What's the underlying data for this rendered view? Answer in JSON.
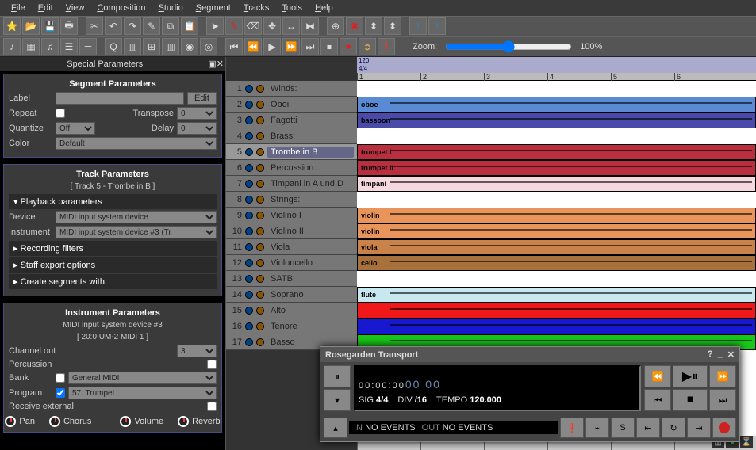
{
  "menu": [
    "File",
    "Edit",
    "View",
    "Composition",
    "Studio",
    "Segment",
    "Tracks",
    "Tools",
    "Help"
  ],
  "zoom": {
    "label": "Zoom:",
    "value": "100%"
  },
  "special_parameters_title": "Special Parameters",
  "seg_params": {
    "title": "Segment Parameters",
    "label_lbl": "Label",
    "edit_btn": "Edit",
    "repeat_lbl": "Repeat",
    "transpose_lbl": "Transpose",
    "transpose_val": "0",
    "quantize_lbl": "Quantize",
    "quantize_val": "Off",
    "delay_lbl": "Delay",
    "delay_val": "0",
    "color_lbl": "Color",
    "color_val": "Default"
  },
  "trk_params": {
    "title": "Track Parameters",
    "sub": "[ Track 5 - Trombe in B ]",
    "playback": "Playback parameters",
    "device_lbl": "Device",
    "device_val": "MIDI input system device",
    "instrument_lbl": "Instrument",
    "instrument_val": "MIDI input system device #3 (Tr",
    "rec": "Recording filters",
    "staff": "Staff export options",
    "create": "Create segments with"
  },
  "inst_params": {
    "title": "Instrument Parameters",
    "sub1": "MIDI input system device  #3",
    "sub2": "[ 20:0 UM-2 MIDI 1 ]",
    "channel_lbl": "Channel out",
    "channel_val": "3",
    "percussion_lbl": "Percussion",
    "bank_lbl": "Bank",
    "bank_val": "General MIDI",
    "program_lbl": "Program",
    "program_val": "57. Trumpet",
    "receive_lbl": "Receive external",
    "knobs": [
      "Pan",
      "Chorus",
      "Volume",
      "Reverb"
    ]
  },
  "tracks": [
    {
      "n": 1,
      "name": "Winds:"
    },
    {
      "n": 2,
      "name": "Oboi"
    },
    {
      "n": 3,
      "name": "Fagotti"
    },
    {
      "n": 4,
      "name": "Brass:"
    },
    {
      "n": 5,
      "name": "Trombe in B",
      "sel": true
    },
    {
      "n": 6,
      "name": "Percussion:"
    },
    {
      "n": 7,
      "name": "Timpani in A und D"
    },
    {
      "n": 8,
      "name": "Strings:"
    },
    {
      "n": 9,
      "name": "Violino I"
    },
    {
      "n": 10,
      "name": "Violino II"
    },
    {
      "n": 11,
      "name": "Viola"
    },
    {
      "n": 12,
      "name": "Violoncello"
    },
    {
      "n": 13,
      "name": "SATB:"
    },
    {
      "n": 14,
      "name": "Soprano"
    },
    {
      "n": 15,
      "name": "Alto"
    },
    {
      "n": 16,
      "name": "Tenore"
    },
    {
      "n": 17,
      "name": "Basso"
    }
  ],
  "ruler": {
    "tempo": "120",
    "sig": "4/4",
    "bars": [
      "1",
      "2",
      "3",
      "4",
      "5",
      "6"
    ]
  },
  "segments": [
    {
      "row": 1,
      "label": "oboe",
      "color": "#5a8ad4"
    },
    {
      "row": 2,
      "label": "bassoon",
      "color": "#4a4aa8"
    },
    {
      "row": 4,
      "label": "trumpet I",
      "color": "#b83040"
    },
    {
      "row": 5,
      "label": "trumpet II",
      "color": "#b83040"
    },
    {
      "row": 6,
      "label": "timpani",
      "color": "#f8d8e0"
    },
    {
      "row": 8,
      "label": "violin",
      "color": "#e8945a"
    },
    {
      "row": 9,
      "label": "violin",
      "color": "#e8945a"
    },
    {
      "row": 10,
      "label": "viola",
      "color": "#c8824a"
    },
    {
      "row": 11,
      "label": "cello",
      "color": "#a8703a"
    },
    {
      "row": 13,
      "label": "flute",
      "color": "#c8e8f0"
    },
    {
      "row": 14,
      "label": "",
      "color": "#f01818"
    },
    {
      "row": 15,
      "label": "",
      "color": "#1818d0"
    },
    {
      "row": 16,
      "label": "",
      "color": "#18c818"
    }
  ],
  "transport": {
    "title": "Rosegarden Transport",
    "time": "00:00:00",
    "ms": "00 00",
    "sig_lbl": "SIG",
    "sig": "4/4",
    "div_lbl": "DIV",
    "div": "/16",
    "tempo_lbl": "TEMPO",
    "tempo": "120.000",
    "in_lbl": "IN",
    "out_lbl": "OUT",
    "noevents": "NO EVENTS"
  }
}
